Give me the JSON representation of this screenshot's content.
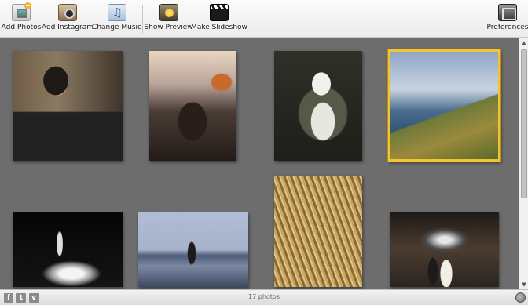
{
  "toolbar": {
    "buttons": [
      {
        "label": "Add Photos",
        "icon": "add-photos-icon"
      },
      {
        "label": "Add Instagram",
        "icon": "instagram-camera-icon"
      },
      {
        "label": "Change Music",
        "icon": "music-note-icon"
      },
      {
        "label": "Show Preview",
        "icon": "sunflower-preview-icon"
      },
      {
        "label": "Make Slideshow",
        "icon": "clapperboard-icon"
      },
      {
        "label": "Preferences",
        "icon": "preferences-screen-icon"
      }
    ]
  },
  "gallery": {
    "photos": [
      {
        "subject": "boy-cooking-noodles",
        "selected": false
      },
      {
        "subject": "people-on-mountain-at-dusk",
        "selected": false
      },
      {
        "subject": "dog-in-armchair",
        "selected": false
      },
      {
        "subject": "mountain-lake-overlook",
        "selected": true
      },
      {
        "subject": "skater-silhouette-in-smoke",
        "selected": false
      },
      {
        "subject": "dancer-leaping-on-beach",
        "selected": false
      },
      {
        "subject": "cornfield-with-children",
        "selected": false
      },
      {
        "subject": "wedding-couple-in-hall",
        "selected": false
      }
    ],
    "selected_border_color": "#f4c430",
    "background_color": "#6d6d6d"
  },
  "statusbar": {
    "photo_count": "17 photos",
    "social": [
      {
        "glyph": "f",
        "icon": "facebook-icon"
      },
      {
        "glyph": "t",
        "icon": "twitter-icon"
      },
      {
        "glyph": "v",
        "icon": "vimeo-icon"
      }
    ],
    "globe_icon": "globe-icon"
  }
}
